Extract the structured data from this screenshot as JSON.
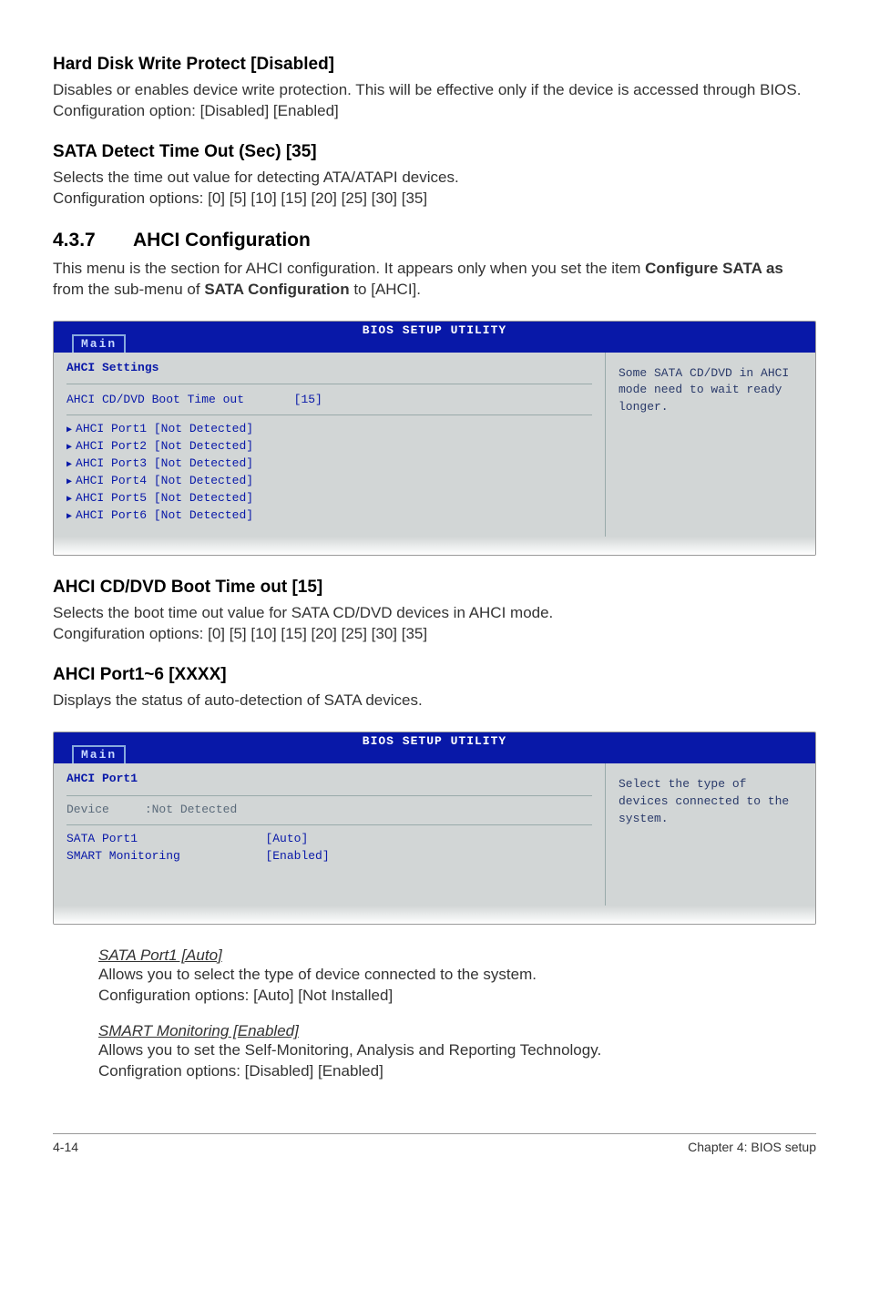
{
  "headings": {
    "hdwp": "Hard Disk Write Protect [Disabled]",
    "sata_detect": "SATA Detect Time Out (Sec) [35]",
    "ahci_conf_num": "4.3.7",
    "ahci_conf_title": "AHCI Configuration",
    "ahci_boot": "AHCI CD/DVD Boot Time out [15]",
    "ahci_port": "AHCI Port1~6 [XXXX]"
  },
  "paragraphs": {
    "hdwp_body": "Disables or enables device write protection. This will be effective only if the device is accessed through BIOS. Configuration option: [Disabled] [Enabled]",
    "sata_detect_l1": "Selects the time out value for detecting ATA/ATAPI devices.",
    "sata_detect_l2": "Configuration options: [0] [5] [10] [15] [20] [25] [30] [35]",
    "ahci_intro_pre": "This menu is the section for AHCI configuration. It appears only when you set the item ",
    "ahci_intro_bold1": "Configure SATA as",
    "ahci_intro_mid": " from the sub-menu of ",
    "ahci_intro_bold2": "SATA Configuration",
    "ahci_intro_post": " to [AHCI].",
    "ahci_boot_l1": "Selects the boot time out value for SATA CD/DVD devices in AHCI mode.",
    "ahci_boot_l2": "Congifuration options: [0] [5] [10] [15] [20] [25] [30] [35]",
    "ahci_port_body": "Displays the status of auto-detection of SATA devices.",
    "sata_port1_h": "SATA Port1 [Auto]",
    "sata_port1_l1": "Allows you to select the type of device connected to the system.",
    "sata_port1_l2": "Configuration options: [Auto] [Not Installed]",
    "smart_h": "SMART Monitoring [Enabled]",
    "smart_l1": "Allows you to set the Self-Monitoring, Analysis and Reporting Technology.",
    "smart_l2": "Configration options: [Disabled] [Enabled]"
  },
  "bios1": {
    "title": "BIOS SETUP UTILITY",
    "tab": "Main",
    "section": "AHCI Settings",
    "boot_row_label": "AHCI CD/DVD Boot Time out",
    "boot_row_value": "[15]",
    "port1": "AHCI Port1 [Not Detected]",
    "port2": "AHCI Port2 [Not Detected]",
    "port3": "AHCI Port3 [Not Detected]",
    "port4": "AHCI Port4 [Not Detected]",
    "port5": "AHCI Port5 [Not Detected]",
    "port6": "AHCI Port6 [Not Detected]",
    "help": "Some SATA CD/DVD in AHCI mode need to wait ready longer."
  },
  "bios2": {
    "title": "BIOS SETUP UTILITY",
    "tab": "Main",
    "section": "AHCI Port1",
    "device_label": "Device",
    "device_value": ":Not Detected",
    "sata_port_label": "SATA Port1",
    "sata_port_value": "[Auto]",
    "smart_label": "SMART Monitoring",
    "smart_value": "[Enabled]",
    "help": "Select the type of devices connected to the system."
  },
  "footer": {
    "page": "4-14",
    "chapter": "Chapter 4: BIOS setup"
  }
}
